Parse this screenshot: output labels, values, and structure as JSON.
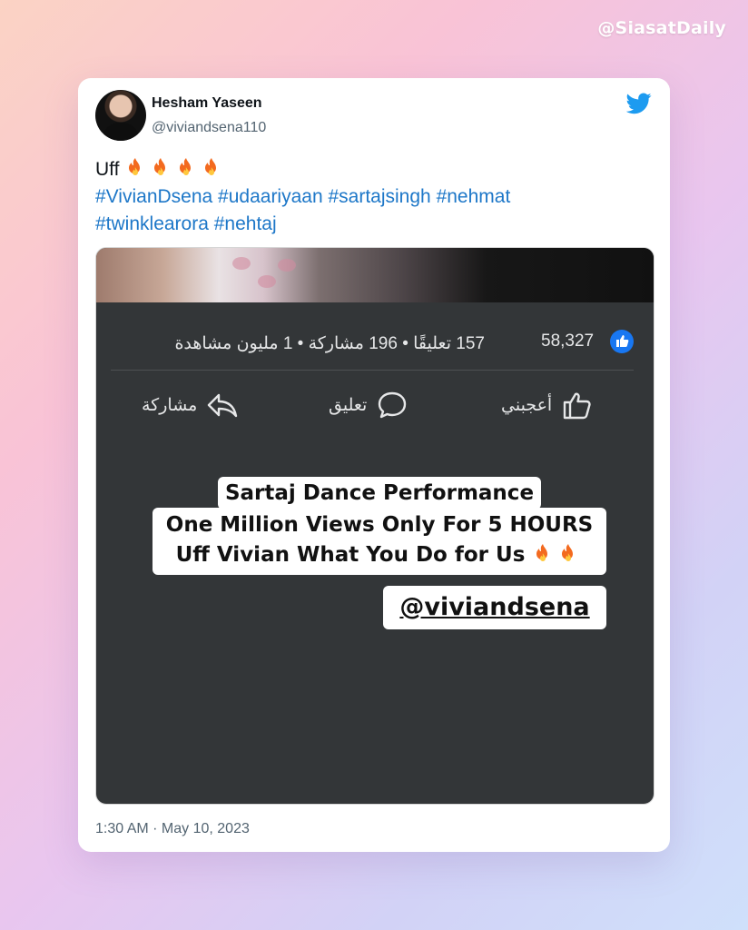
{
  "watermark": "@SiasatDaily",
  "tweet": {
    "author_name": "Hesham Yaseen",
    "author_handle": "@viviandsena110",
    "text_prefix": "Uff",
    "hashtags_line1": [
      "#VivianDsena",
      "#udaariyaan",
      "#sartajsingh",
      "#nehmat"
    ],
    "hashtags_line2": [
      "#twinklearora",
      "#nehtaj"
    ],
    "timestamp": "1:30 AM · May 10, 2023",
    "flame_count": 4
  },
  "media": {
    "fb_stats": {
      "reaction_count": "58,327",
      "meta": "157 تعليقًا • 196 مشاركة • 1 مليون مشاهدة"
    },
    "fb_actions": {
      "like": "أعجبني",
      "comment": "تعليق",
      "share": "مشاركة"
    },
    "overlay": {
      "line1": "Sartaj Dance Performance",
      "line2": "One Million Views Only For 5 HOURS",
      "line3": "Uff Vivian What You Do for Us",
      "handle": "@viviandsena"
    }
  },
  "colors": {
    "hashtag": "#1d77c8",
    "twitter_blue": "#1d9bf0",
    "fb_blue": "#1877f2",
    "media_bg": "#333638"
  },
  "icons": [
    "twitter-bird-icon",
    "fire-emoji-icon",
    "facebook-like-badge-icon",
    "thumbs-up-icon",
    "comment-bubble-icon",
    "share-arrow-icon"
  ]
}
